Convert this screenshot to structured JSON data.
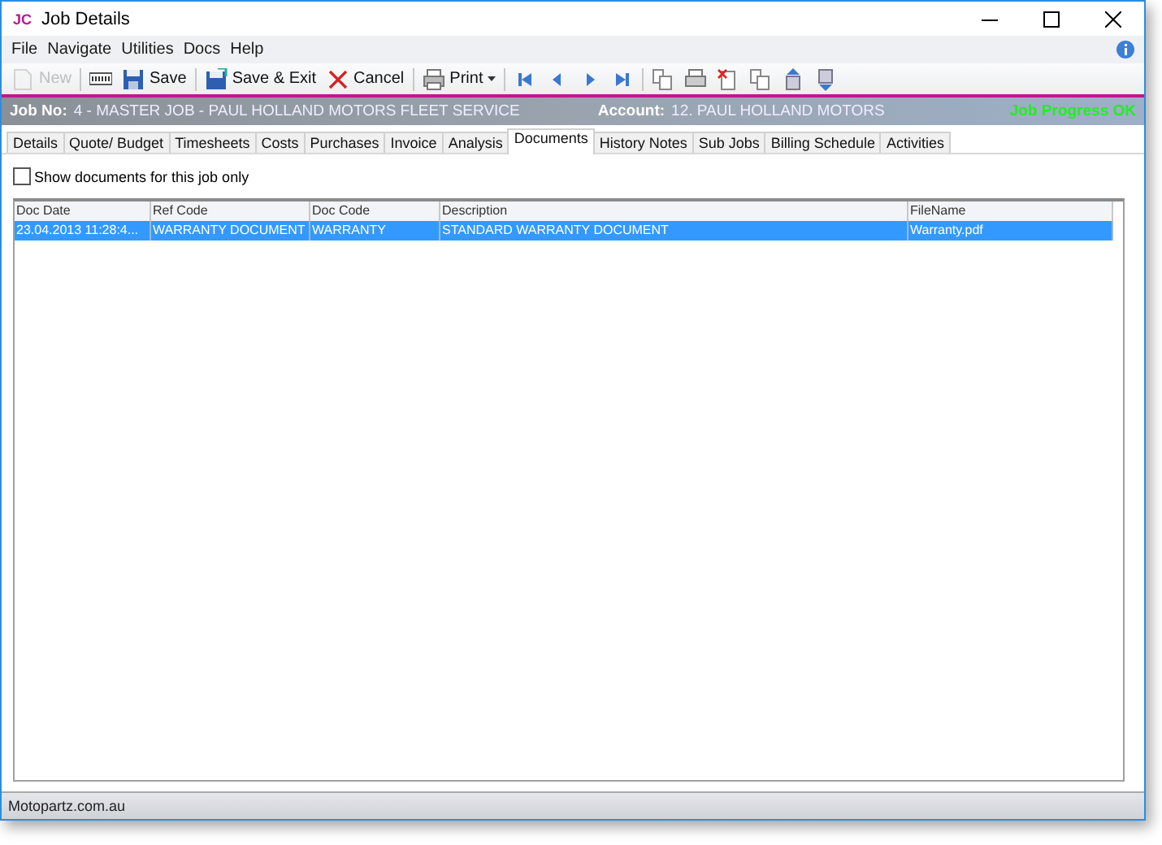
{
  "window": {
    "logo": "JC",
    "title": "Job Details"
  },
  "menu": [
    {
      "label": "File"
    },
    {
      "label": "Navigate"
    },
    {
      "label": "Utilities"
    },
    {
      "label": "Docs"
    },
    {
      "label": "Help"
    }
  ],
  "toolbar": [
    {
      "kind": "new",
      "label": "New",
      "disabled": true
    },
    {
      "kind": "sep"
    },
    {
      "kind": "scan",
      "disabled": false
    },
    {
      "kind": "save",
      "label": "Save",
      "disabled": false
    },
    {
      "kind": "sep"
    },
    {
      "kind": "saveexit",
      "label": "Save & Exit",
      "disabled": false
    },
    {
      "kind": "cancel",
      "label": "Cancel",
      "disabled": false
    },
    {
      "kind": "sep"
    },
    {
      "kind": "print",
      "label": "Print",
      "disabled": false
    },
    {
      "kind": "sep"
    },
    {
      "kind": "first",
      "disabled": false
    },
    {
      "kind": "prev",
      "disabled": false
    },
    {
      "kind": "next",
      "disabled": false
    },
    {
      "kind": "last",
      "disabled": false
    },
    {
      "kind": "sep"
    },
    {
      "kind": "copy",
      "disabled": false
    },
    {
      "kind": "printer",
      "disabled": false
    },
    {
      "kind": "delete",
      "disabled": false
    },
    {
      "kind": "copy",
      "disabled": false
    },
    {
      "kind": "up",
      "disabled": false
    },
    {
      "kind": "down",
      "disabled": false
    }
  ],
  "header": {
    "job_label": "Job No:",
    "job_value": "4 - MASTER JOB - PAUL HOLLAND MOTORS FLEET SERVICE",
    "account_label": "Account:",
    "account_value": "12. PAUL HOLLAND MOTORS",
    "status": "Job Progress OK"
  },
  "tabs": [
    {
      "label": "Details",
      "selected": false
    },
    {
      "label": "Quote/ Budget",
      "selected": false
    },
    {
      "label": "Timesheets",
      "selected": false
    },
    {
      "label": "Costs",
      "selected": false
    },
    {
      "label": "Purchases",
      "selected": false
    },
    {
      "label": "Invoice",
      "selected": false
    },
    {
      "label": "Analysis",
      "selected": false
    },
    {
      "label": "Documents",
      "selected": true
    },
    {
      "label": "History Notes",
      "selected": false
    },
    {
      "label": "Sub Jobs",
      "selected": false
    },
    {
      "label": "Billing Schedule",
      "selected": false
    },
    {
      "label": "Activities",
      "selected": false
    }
  ],
  "filter": {
    "label": "Show documents for this job only",
    "checked": false
  },
  "table": {
    "columns": [
      "Doc Date",
      "Ref Code",
      "Doc Code",
      "Description",
      "FileName"
    ],
    "rows": [
      {
        "cells": [
          "23.04.2013 11:28:4...",
          "WARRANTY DOCUMENT",
          "WARRANTY",
          "STANDARD WARRANTY DOCUMENT",
          "Warranty.pdf"
        ],
        "selected": true
      }
    ]
  },
  "status_bar": "Motopartz.com.au"
}
